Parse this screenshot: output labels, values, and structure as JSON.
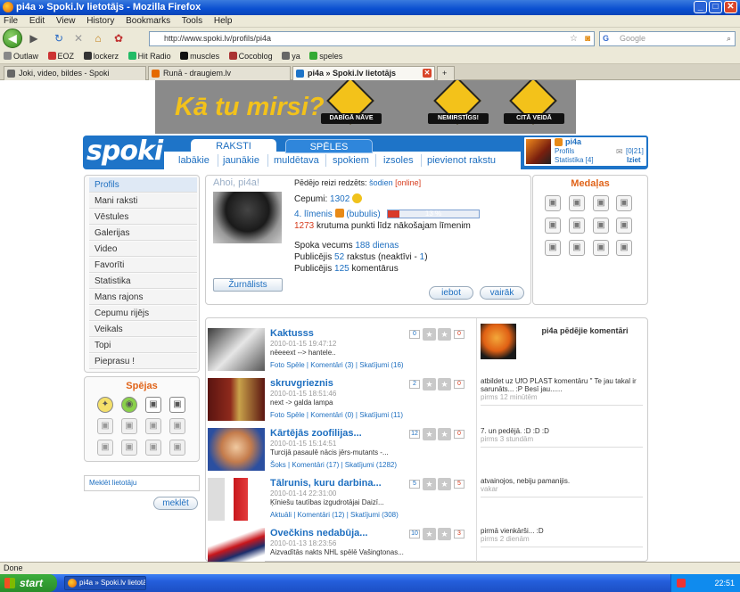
{
  "window": {
    "title": "pi4a » Spoki.lv lietotājs - Mozilla Firefox"
  },
  "menu": [
    "File",
    "Edit",
    "View",
    "History",
    "Bookmarks",
    "Tools",
    "Help"
  ],
  "nav": {
    "url": "http://www.spoki.lv/profils/pi4a",
    "search_placeholder": "Google"
  },
  "bookmarks": [
    "Outlaw",
    "EOZ",
    "lockerz",
    "Hit Radio",
    "muscles",
    "Cocoblog",
    "ya",
    "speles"
  ],
  "tabs": [
    {
      "label": "Joki, video, bildes - Spoki"
    },
    {
      "label": "Runā - draugiem.lv"
    },
    {
      "label": "pi4a » Spoki.lv lietotājs"
    }
  ],
  "banner": {
    "slogan": "Kā tu mirsi?",
    "signs": [
      "DABĪGĀ NĀVE",
      "NEMIRSTĪGS!",
      "CITĀ VEIDĀ"
    ]
  },
  "site": {
    "logo": "spoki",
    "top_tabs": [
      "RAKSTI",
      "SPĒLES"
    ],
    "nav_links": [
      "labākie",
      "jaunākie",
      "muldētava",
      "spokiem",
      "izsoles",
      "pievienot rakstu"
    ]
  },
  "userbox": {
    "name": "pi4a",
    "profile": "Profils",
    "stats": "Statistika [4]",
    "messages": "[0|21]",
    "logout": "Iziet"
  },
  "sidebar": {
    "items": [
      "Profils",
      "Mani raksti",
      "Vēstules",
      "Galerijas",
      "Video",
      "Favorīti",
      "Statistika",
      "Mans rajons",
      "Cepumu rijējs",
      "Veikals",
      "Topi",
      "Pieprasu !"
    ],
    "spejas_title": "Spējas",
    "search_link": "Meklēt lietotāju",
    "search_button": "meklēt"
  },
  "profile": {
    "greeting": "Ahoi, pi4a!",
    "last_seen_label": "Pēdējo reizi redzēts:",
    "last_seen": "šodien",
    "online": "[online]",
    "cookies_label": "Cepumi:",
    "cookies": "1302",
    "level": "4. līmenis",
    "level_name": "(bubulis)",
    "progress_pct": 13,
    "progress_label": "13 %",
    "points_value": "1273",
    "points_text": "krutuma punkti līdz nākošajam līmenim",
    "age_label": "Spoka vecums",
    "age": "188 dienas",
    "published_label": "Publicējis",
    "published": "52",
    "published_mid": "rakstus (neaktīvi -",
    "inactive": "1",
    "published_end": ")",
    "comments_label": "Publicējis",
    "comments": "125",
    "comments_end": "komentārus",
    "badge": "Žurnālists",
    "btn_like": "iebot",
    "btn_more": "vairāk"
  },
  "medals_title": "Medaļas",
  "articles": [
    {
      "title": "Kaktusss",
      "date": "2010-01-15 19:47:12",
      "excerpt": "nēeeext --> hantele..",
      "cat": "Foto Spēle",
      "comments": "Komentāri (3)",
      "views": "Skatījumi (16)",
      "v_left": "0",
      "v_right": "0"
    },
    {
      "title": "skruvgrieznis",
      "date": "2010-01-15 18:51:46",
      "excerpt": "next -> galda lampa",
      "cat": "Foto Spēle",
      "comments": "Komentāri (0)",
      "views": "Skatījumi (11)",
      "v_left": "2",
      "v_right": "0"
    },
    {
      "title": "Kārtējās zoofilijas...",
      "date": "2010-01-15 15:14:51",
      "excerpt": "Turcijā pasaulē nācis jērs-mutants -...",
      "cat": "Šoks",
      "comments": "Komentāri (17)",
      "views": "Skatījumi (1282)",
      "v_left": "12",
      "v_right": "0"
    },
    {
      "title": "Tālrunis, kuru darbina...",
      "date": "2010-01-14 22:31:00",
      "excerpt": "Ķīniešu tautības izgudrotājai Daizī...",
      "cat": "Aktuāli",
      "comments": "Komentāri (12)",
      "views": "Skatījumi (308)",
      "v_left": "5",
      "v_right": "5"
    },
    {
      "title": "Ovečkins nedabūja...",
      "date": "2010-01-13 18:23:56",
      "excerpt": "Aizvadītās nakts NHL spēlē Vašingtonas...",
      "cat": "",
      "comments": "",
      "views": "",
      "v_left": "10",
      "v_right": "3"
    }
  ],
  "comments_panel": {
    "title": "pi4a pēdējie komentāri",
    "items": [
      {
        "text": "atbildet uz UfO PLAST komentāru \" Te jau takal ir sarunāts... :P  Besī jau......",
        "when": "pirms 12 minūtēm"
      },
      {
        "text": "7. un pedējā. :D :D :D",
        "when": "pirms 3 stundām"
      },
      {
        "text": "atvainojos, nebiju pamanijis.",
        "when": "vakar"
      },
      {
        "text": "pirmā vienkārši...  :D",
        "when": "pirms 2 dienām"
      }
    ]
  },
  "status": "Done",
  "taskbar": {
    "start": "start",
    "item": "pi4a » Spoki.lv lietotā...",
    "clock": "22:51"
  }
}
